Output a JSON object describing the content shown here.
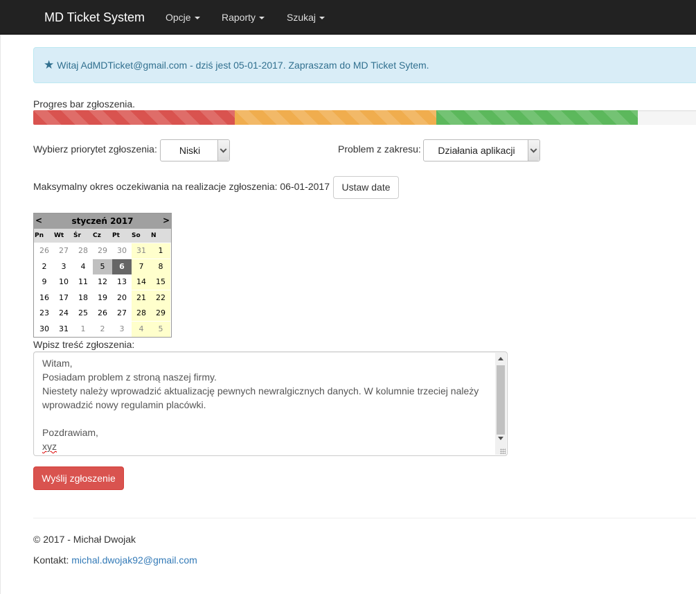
{
  "navbar": {
    "brand": "MD Ticket System",
    "items": [
      {
        "label": "Opcje"
      },
      {
        "label": "Raporty"
      },
      {
        "label": "Szukaj"
      }
    ]
  },
  "alert": {
    "icon": "star-icon",
    "text": "Witaj AdMDTicket@gmail.com - dziś jest 05-01-2017. Zapraszam do MD Ticket Sytem."
  },
  "progress": {
    "label": "Progres bar zgłoszenia.",
    "segments": [
      {
        "color": "#d9534f",
        "percent": 30
      },
      {
        "color": "#f0ad4e",
        "percent": 30
      },
      {
        "color": "#5cb85c",
        "percent": 30
      }
    ]
  },
  "priority": {
    "label": "Wybierz priorytet zgłoszenia:",
    "value": "Niski"
  },
  "scope": {
    "label": "Problem z zakresu:",
    "value": "Działania aplikacji"
  },
  "deadline": {
    "label": "Maksymalny okres oczekiwania na realizacje zgłoszenia: 06-01-2017",
    "button": "Ustaw date"
  },
  "calendar": {
    "prev": "<",
    "next": ">",
    "title": "styczeń 2017",
    "weekdays": [
      "Pn",
      "Wt",
      "Śr",
      "Cz",
      "Pt",
      "So",
      "N"
    ],
    "weeks": [
      [
        "26",
        "27",
        "28",
        "29",
        "30",
        "31",
        "1"
      ],
      [
        "2",
        "3",
        "4",
        "5",
        "6",
        "7",
        "8"
      ],
      [
        "9",
        "10",
        "11",
        "12",
        "13",
        "14",
        "15"
      ],
      [
        "16",
        "17",
        "18",
        "19",
        "20",
        "21",
        "22"
      ],
      [
        "23",
        "24",
        "25",
        "26",
        "27",
        "28",
        "29"
      ],
      [
        "30",
        "31",
        "1",
        "2",
        "3",
        "4",
        "5"
      ]
    ],
    "today": "5",
    "selected": "6"
  },
  "message": {
    "label": "Wpisz treść zgłoszenia:",
    "lines": [
      "Witam,",
      "Posiadam problem z stroną naszej firmy.",
      "Niestety należy wprowadzić aktualizację pewnych newralgicznych danych. W kolumnie trzeciej należy",
      "wprowadzić nowy regulamin placówki.",
      "",
      "Pozdrawiam,",
      "xyz"
    ]
  },
  "submit": {
    "label": "Wyślij zgłoszenie"
  },
  "footer": {
    "copyright": "© 2017 - Michał Dwojak",
    "contact_label": "Kontakt:",
    "contact_email": "michal.dwojak92@gmail.com"
  }
}
